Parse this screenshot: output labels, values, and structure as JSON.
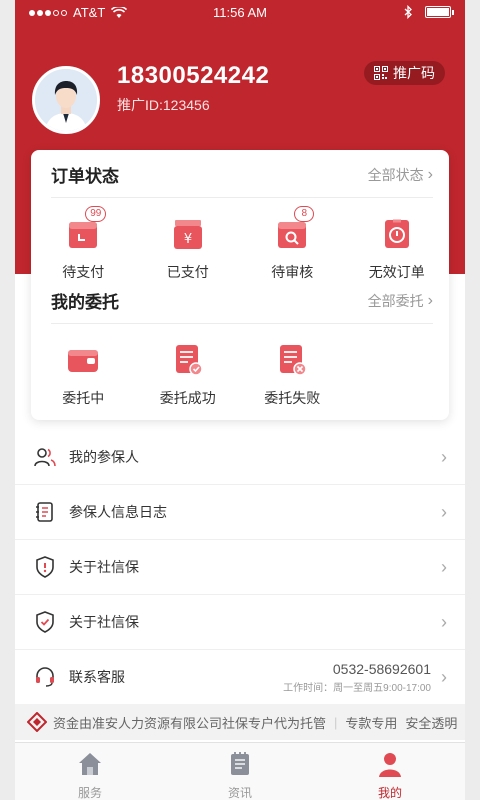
{
  "status_bar": {
    "carrier": "AT&T",
    "time": "11:56 AM"
  },
  "profile": {
    "phone": "18300524242",
    "promo_id_label": "推广ID:",
    "promo_id": "123456",
    "qr_button": "推广码"
  },
  "orders": {
    "title": "订单状态",
    "all_link": "全部状态",
    "items": [
      {
        "label": "待支付",
        "icon": "wallet-clock-icon",
        "badge": "99"
      },
      {
        "label": "已支付",
        "icon": "yen-wallet-icon",
        "badge": ""
      },
      {
        "label": "待审核",
        "icon": "search-doc-icon",
        "badge": "8"
      },
      {
        "label": "无效订单",
        "icon": "invalid-order-icon",
        "badge": ""
      }
    ]
  },
  "entrust": {
    "title": "我的委托",
    "all_link": "全部委托",
    "items": [
      {
        "label": "委托中",
        "icon": "wallet-icon"
      },
      {
        "label": "委托成功",
        "icon": "doc-check-icon"
      },
      {
        "label": "委托失败",
        "icon": "doc-x-icon"
      }
    ]
  },
  "menu": [
    {
      "label": "我的参保人",
      "icon": "people-icon"
    },
    {
      "label": "参保人信息日志",
      "icon": "log-icon"
    },
    {
      "label": "关于社信保",
      "icon": "shield-alert-icon"
    },
    {
      "label": "关于社信保",
      "icon": "shield-check-icon"
    },
    {
      "label": "联系客服",
      "icon": "headset-icon",
      "phone": "0532-58692601",
      "hours": "工作时间：周一至周五9:00-17:00"
    }
  ],
  "notice": {
    "text": "资金由准安人力资源有限公司社保专户代为托管",
    "tag1": "专款专用",
    "tag2": "安全透明"
  },
  "tabs": [
    {
      "label": "服务",
      "icon": "home-icon",
      "active": false
    },
    {
      "label": "资讯",
      "icon": "news-icon",
      "active": false
    },
    {
      "label": "我的",
      "icon": "user-icon",
      "active": true
    }
  ],
  "colors": {
    "brand": "#c0262d",
    "accent": "#e04a52"
  }
}
